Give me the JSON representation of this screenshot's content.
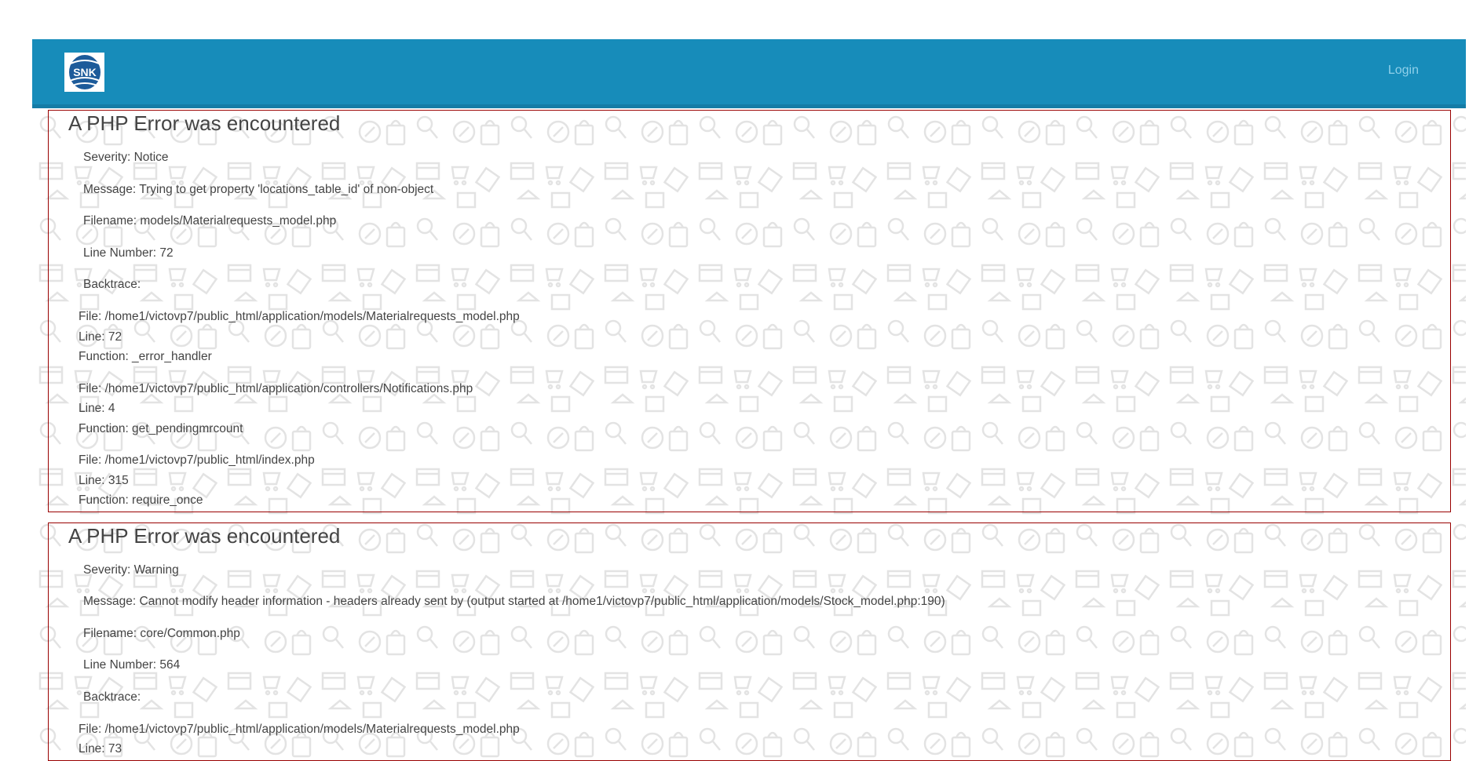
{
  "header": {
    "logo_text": "SNK",
    "login_label": "Login"
  },
  "colors": {
    "navbar": "#178cba",
    "error_border": "#990000"
  },
  "errors": [
    {
      "title": "A PHP Error was encountered",
      "severity": "Severity: Notice",
      "message": "Message: Trying to get property 'locations_table_id' of non-object",
      "filename": "Filename: models/Materialrequests_model.php",
      "line_number": "Line Number: 72",
      "backtrace_label": "Backtrace:",
      "backtrace": [
        {
          "file": "File: /home1/victovp7/public_html/application/models/Materialrequests_model.php",
          "line": "Line: 72",
          "function": "Function: _error_handler"
        },
        {
          "file": "File: /home1/victovp7/public_html/application/controllers/Notifications.php",
          "line": "Line: 4",
          "function": "Function: get_pendingmrcount"
        },
        {
          "file": "File: /home1/victovp7/public_html/index.php",
          "line": "Line: 315",
          "function": "Function: require_once"
        }
      ]
    },
    {
      "title": "A PHP Error was encountered",
      "severity": "Severity: Warning",
      "message": "Message: Cannot modify header information - headers already sent by (output started at /home1/victovp7/public_html/application/models/Stock_model.php:190)",
      "filename": "Filename: core/Common.php",
      "line_number": "Line Number: 564",
      "backtrace_label": "Backtrace:",
      "backtrace": [
        {
          "file": "File: /home1/victovp7/public_html/application/models/Materialrequests_model.php",
          "line": "Line: 73"
        }
      ]
    }
  ]
}
